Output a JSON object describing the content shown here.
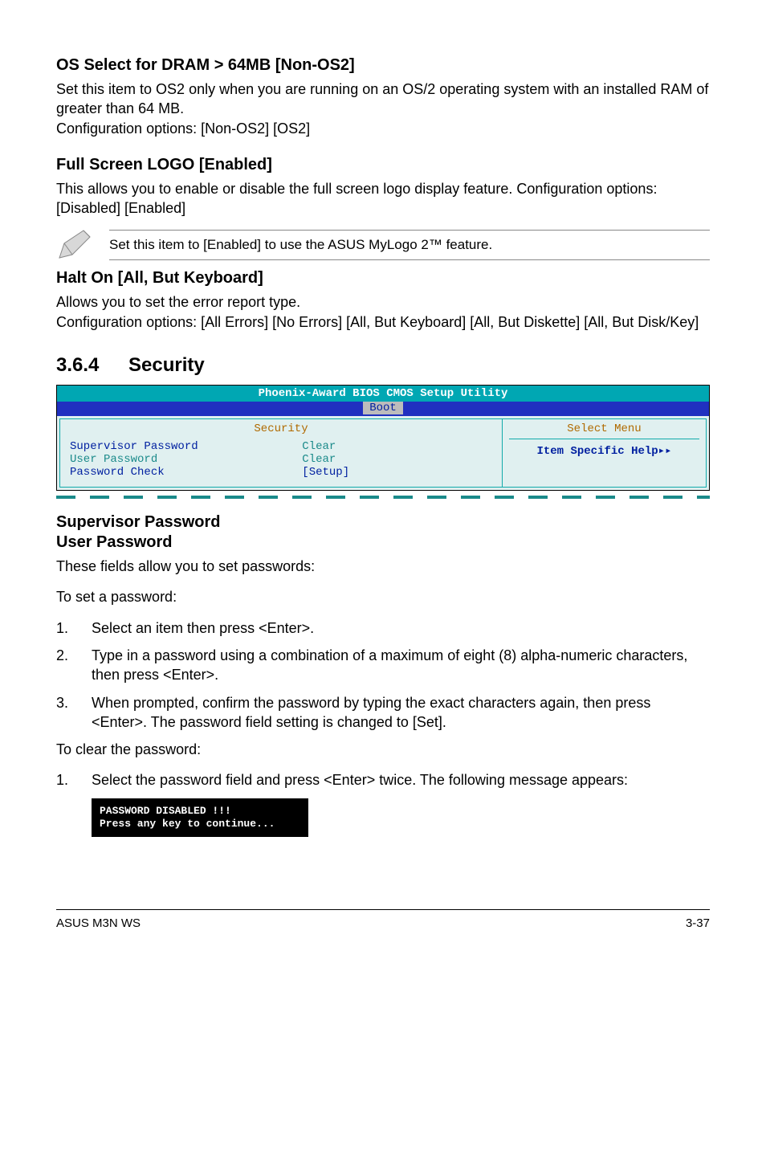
{
  "sec1": {
    "title": "OS Select for DRAM > 64MB [Non-OS2]",
    "p1": "Set this item to OS2 only when you are running on an OS/2 operating system with an installed RAM of greater than 64 MB.",
    "p2": "Configuration options: [Non-OS2] [OS2]"
  },
  "sec2": {
    "title": "Full Screen LOGO [Enabled]",
    "p1": "This allows you to enable or disable the full screen logo display feature. Configuration options: [Disabled] [Enabled]"
  },
  "note": {
    "text": "Set this item to [Enabled] to use the ASUS MyLogo 2™ feature."
  },
  "sec3": {
    "title": "Halt On [All, But Keyboard]",
    "p1": "Allows you to set the error report type.",
    "p2": "Configuration options: [All Errors] [No Errors] [All, But Keyboard] [All, But Diskette] [All, But Disk/Key]"
  },
  "heading": {
    "num": "3.6.4",
    "text": "Security"
  },
  "bios": {
    "title": "Phoenix-Award BIOS CMOS Setup Utility",
    "tab": "Boot",
    "left_title": "Security",
    "rows": [
      {
        "label": "Supervisor Password",
        "value": "Clear",
        "highlight": true
      },
      {
        "label": "User Password",
        "value": "Clear",
        "highlight": false
      },
      {
        "label": "Password Check",
        "value": "[Setup]",
        "highlight": false,
        "val_blue": true
      }
    ],
    "right_title": "Select Menu",
    "right_help": "Item Specific Help▸▸"
  },
  "sec4": {
    "title1": "Supervisor Password",
    "title2": "User Password",
    "p1": "These fields allow you to set passwords:",
    "p2": "To set a password:",
    "list1": [
      "Select an item then press <Enter>.",
      "Type in a password using a combination of a maximum of eight (8) alpha-numeric characters, then press <Enter>.",
      "When prompted, confirm the password by typing the exact characters again, then press <Enter>. The password field setting is changed to [Set]."
    ],
    "p3": "To clear the password:",
    "list2": [
      "Select the password field and press <Enter> twice. The following message appears:"
    ],
    "box_line1": "PASSWORD DISABLED !!!",
    "box_line2": "Press any key to continue..."
  },
  "footer": {
    "left": "ASUS M3N WS",
    "right": "3-37"
  }
}
